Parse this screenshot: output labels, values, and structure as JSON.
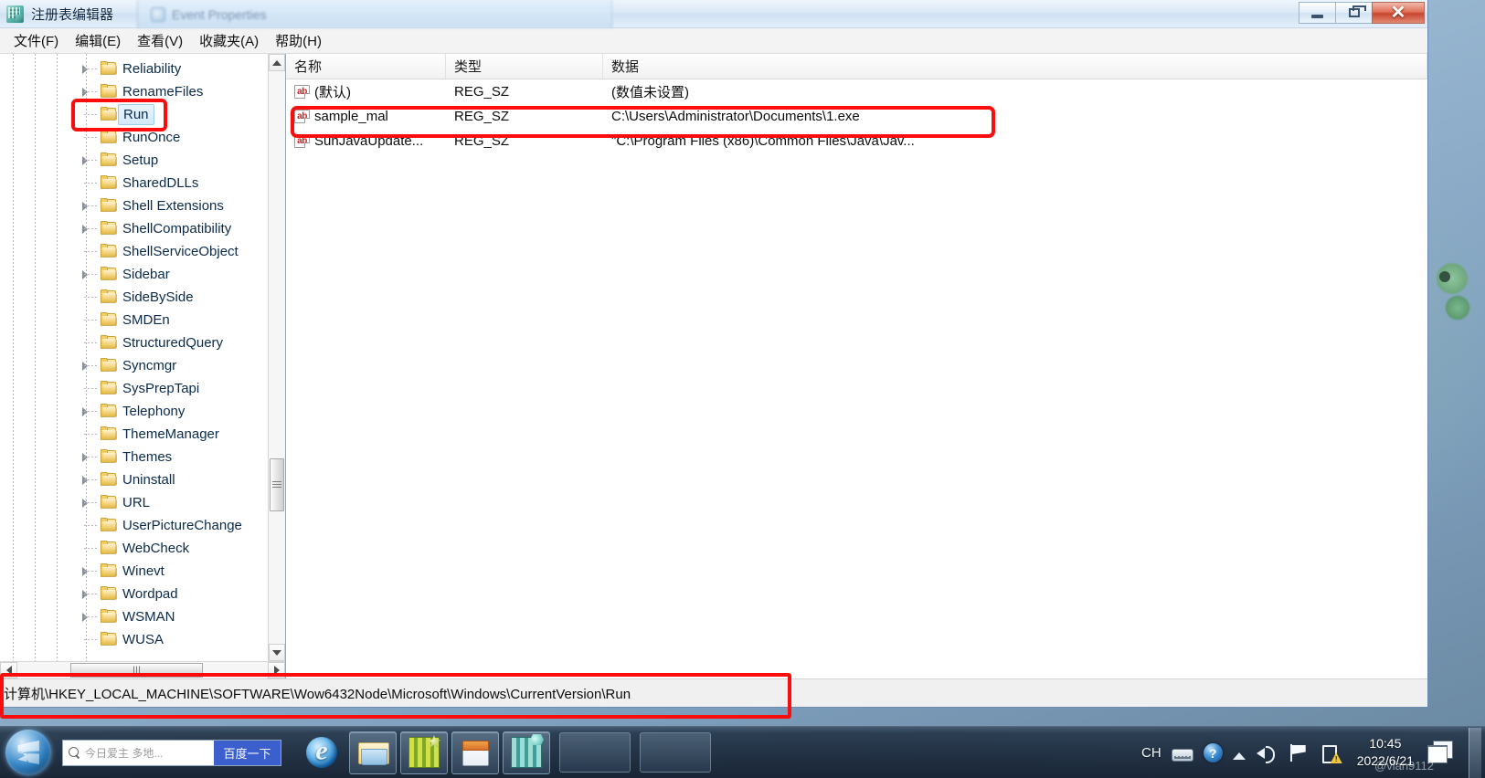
{
  "window": {
    "title": "注册表编辑器",
    "app_icon": "registry-editor-icon",
    "ghost_window_title": "Event Properties",
    "buttons": {
      "minimize": "minimize-button",
      "maximize": "restore-button",
      "close": "✕"
    }
  },
  "menubar": {
    "items": [
      {
        "label": "文件(F)",
        "name": "menu-file"
      },
      {
        "label": "编辑(E)",
        "name": "menu-edit"
      },
      {
        "label": "查看(V)",
        "name": "menu-view"
      },
      {
        "label": "收藏夹(A)",
        "name": "menu-favorites"
      },
      {
        "label": "帮助(H)",
        "name": "menu-help"
      }
    ]
  },
  "tree": {
    "items": [
      {
        "label": "Reliability",
        "expandable": true,
        "selected": false
      },
      {
        "label": "RenameFiles",
        "expandable": true,
        "selected": false
      },
      {
        "label": "Run",
        "expandable": false,
        "selected": true
      },
      {
        "label": "RunOnce",
        "expandable": false,
        "selected": false
      },
      {
        "label": "Setup",
        "expandable": true,
        "selected": false
      },
      {
        "label": "SharedDLLs",
        "expandable": false,
        "selected": false
      },
      {
        "label": "Shell Extensions",
        "expandable": true,
        "selected": false
      },
      {
        "label": "ShellCompatibility",
        "expandable": true,
        "selected": false
      },
      {
        "label": "ShellServiceObject",
        "expandable": false,
        "selected": false
      },
      {
        "label": "Sidebar",
        "expandable": true,
        "selected": false
      },
      {
        "label": "SideBySide",
        "expandable": false,
        "selected": false
      },
      {
        "label": "SMDEn",
        "expandable": false,
        "selected": false
      },
      {
        "label": "StructuredQuery",
        "expandable": false,
        "selected": false
      },
      {
        "label": "Syncmgr",
        "expandable": true,
        "selected": false
      },
      {
        "label": "SysPrepTapi",
        "expandable": false,
        "selected": false
      },
      {
        "label": "Telephony",
        "expandable": true,
        "selected": false
      },
      {
        "label": "ThemeManager",
        "expandable": false,
        "selected": false
      },
      {
        "label": "Themes",
        "expandable": true,
        "selected": false
      },
      {
        "label": "Uninstall",
        "expandable": true,
        "selected": false
      },
      {
        "label": "URL",
        "expandable": true,
        "selected": false
      },
      {
        "label": "UserPictureChange",
        "expandable": false,
        "selected": false
      },
      {
        "label": "WebCheck",
        "expandable": false,
        "selected": false
      },
      {
        "label": "Winevt",
        "expandable": true,
        "selected": false
      },
      {
        "label": "Wordpad",
        "expandable": true,
        "selected": false
      },
      {
        "label": "WSMAN",
        "expandable": true,
        "selected": false
      },
      {
        "label": "WUSA",
        "expandable": false,
        "selected": false
      }
    ]
  },
  "list": {
    "columns": [
      "名称",
      "类型",
      "数据"
    ],
    "rows": [
      {
        "name": "(默认)",
        "type": "REG_SZ",
        "data": "(数值未设置)",
        "highlighted": false
      },
      {
        "name": "sample_mal",
        "type": "REG_SZ",
        "data": "C:\\Users\\Administrator\\Documents\\1.exe",
        "highlighted": true
      },
      {
        "name": "SunJavaUpdate...",
        "type": "REG_SZ",
        "data": "\"C:\\Program Files (x86)\\Common Files\\Java\\Jav...",
        "highlighted": false
      }
    ],
    "value_icon": "ab"
  },
  "statusbar": {
    "path": "计算机\\HKEY_LOCAL_MACHINE\\SOFTWARE\\Wow6432Node\\Microsoft\\Windows\\CurrentVersion\\Run"
  },
  "annotations": {
    "accent_color": "#fb0d0d",
    "boxes": [
      {
        "name": "annotation-box-run-key"
      },
      {
        "name": "annotation-box-sample-mal-row"
      },
      {
        "name": "annotation-box-registry-path"
      }
    ]
  },
  "taskbar": {
    "start_button": "start-orb",
    "search": {
      "placeholder": "今日爱主 多地...",
      "button_label": "百度一下"
    },
    "pinned": [
      {
        "name": "taskbar-item-internet-explorer",
        "icon": "internet-explorer-icon"
      },
      {
        "name": "taskbar-item-file-explorer",
        "icon": "folder-icon"
      },
      {
        "name": "taskbar-item-green-app",
        "icon": "grid-app-icon"
      },
      {
        "name": "taskbar-item-notepad",
        "icon": "notepad-icon"
      },
      {
        "name": "taskbar-item-teal-app",
        "icon": "cube-app-icon"
      }
    ],
    "tray": {
      "input_indicator": "CH",
      "icons": [
        "keyboard-icon",
        "help-icon",
        "chevron-up-icon",
        "volume-icon",
        "flag-icon",
        "action-center-icon"
      ],
      "time": "10:45",
      "date": "2022/6/21"
    },
    "watermark": "@vlan9112"
  }
}
